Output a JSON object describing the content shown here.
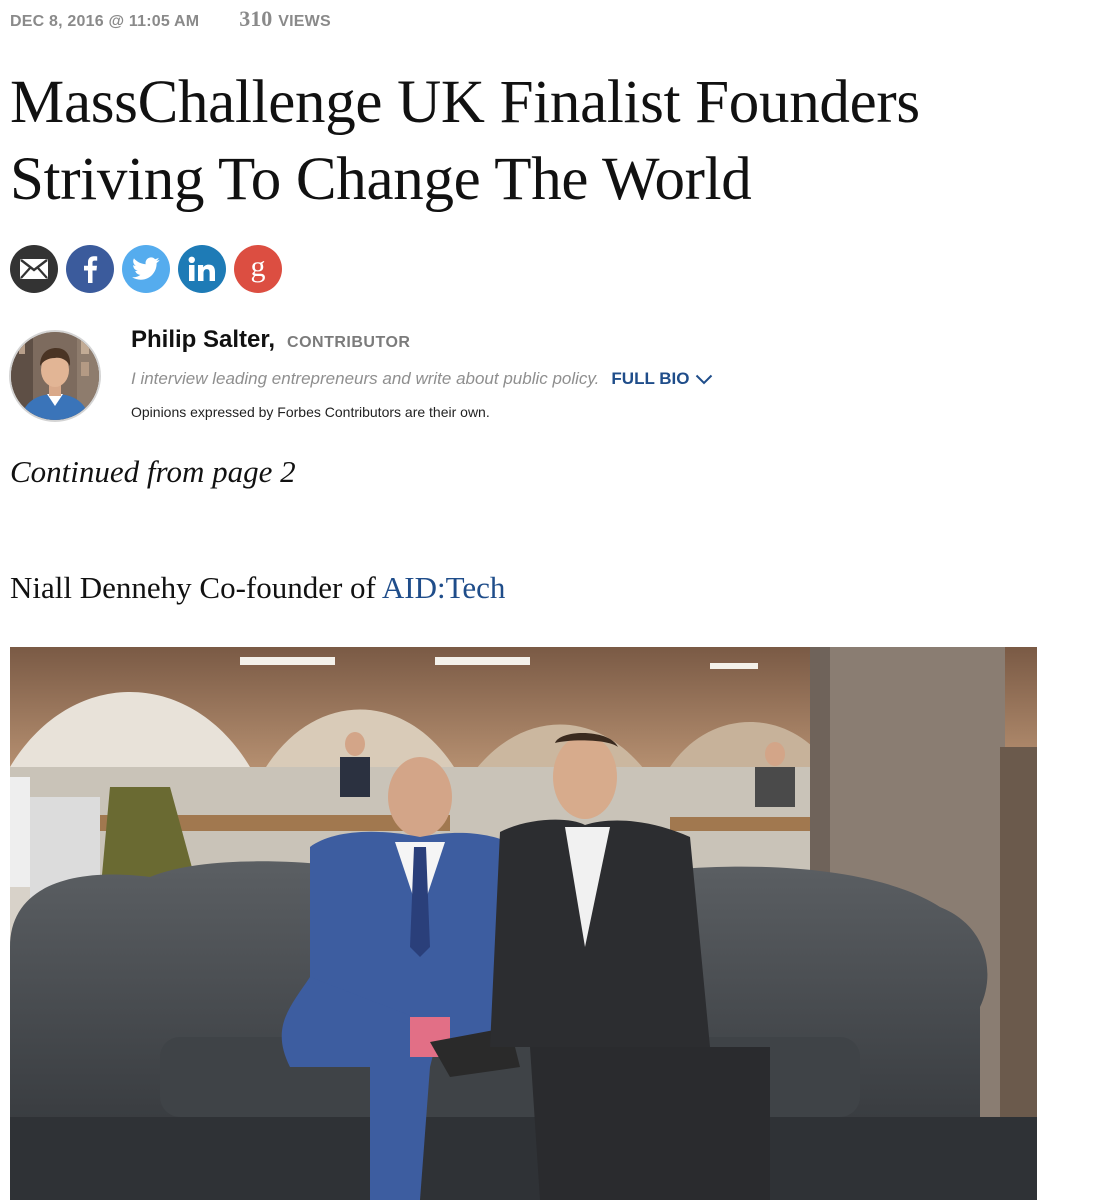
{
  "meta": {
    "date": "DEC 8, 2016 @ 11:05 AM",
    "views_count": "310",
    "views_label": "VIEWS"
  },
  "article": {
    "title": "MassChallenge UK Finalist Founders Striving To Change The World",
    "continued": "Continued from page 2",
    "paragraph_prefix": "Niall Dennehy Co-founder of ",
    "paragraph_link": "AID:Tech"
  },
  "share": {
    "icons": [
      {
        "name": "email-icon",
        "color": "#333333"
      },
      {
        "name": "facebook-icon",
        "color": "#3b5b9c"
      },
      {
        "name": "twitter-icon",
        "color": "#55acee"
      },
      {
        "name": "linkedin-icon",
        "color": "#1e7bb6"
      },
      {
        "name": "google-plus-icon",
        "color": "#dc4e41"
      }
    ]
  },
  "author": {
    "name": "Philip Salter,",
    "role": "CONTRIBUTOR",
    "bio": "I interview leading entrepreneurs and write about public policy.",
    "full_bio_label": "FULL BIO",
    "disclaimer": "Opinions expressed by Forbes Contributors are their own."
  },
  "colors": {
    "link": "#1f4d8a",
    "meta_gray": "#8a8a8a"
  }
}
